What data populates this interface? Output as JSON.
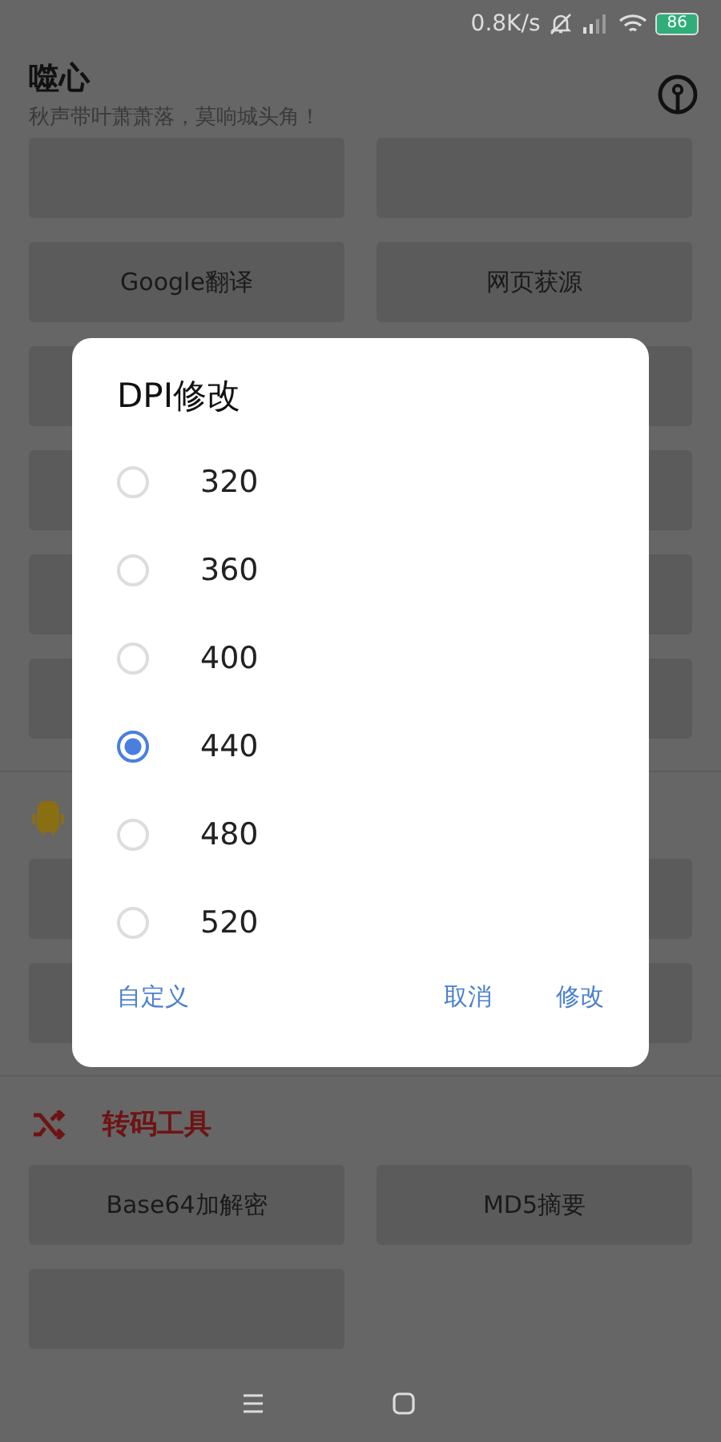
{
  "status_bar": {
    "speed": "0.8K/s",
    "battery": "86"
  },
  "header": {
    "title": "噬心",
    "subtitle": "秋声带叶萧萧落，莫响城头角！"
  },
  "sections": [
    {
      "rows": [
        [
          null,
          null
        ],
        [
          "Google翻译",
          "网页获源"
        ],
        [
          null,
          null
        ],
        [
          null,
          null
        ],
        [
          null,
          null
        ],
        [
          null,
          null
        ]
      ]
    },
    {
      "kind": "android",
      "color": "#8a6e12",
      "rows": [
        [
          null,
          null
        ],
        [
          null,
          null
        ]
      ]
    },
    {
      "kind": "shuffle",
      "title": "转码工具",
      "color": "#6e1414",
      "rows": [
        [
          "Base64加解密",
          "MD5摘要"
        ],
        [
          null
        ]
      ]
    }
  ],
  "dialog": {
    "title": "DPI修改",
    "options": [
      {
        "label": "320",
        "selected": false
      },
      {
        "label": "360",
        "selected": false
      },
      {
        "label": "400",
        "selected": false
      },
      {
        "label": "440",
        "selected": true
      },
      {
        "label": "480",
        "selected": false
      },
      {
        "label": "520",
        "selected": false
      }
    ],
    "left_action": "自定义",
    "actions": [
      "取消",
      "修改"
    ]
  }
}
